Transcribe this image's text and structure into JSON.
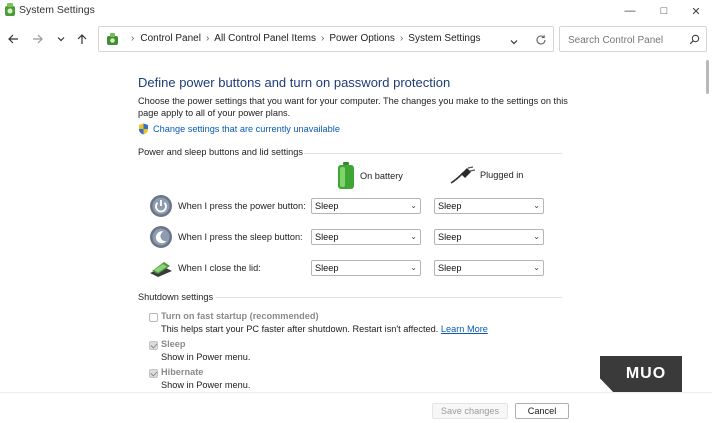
{
  "window": {
    "title": "System Settings",
    "minimize_glyph": "—",
    "maximize_glyph": "□",
    "close_glyph": "✕"
  },
  "nav": {
    "breadcrumbs": [
      "Control Panel",
      "All Control Panel Items",
      "Power Options",
      "System Settings"
    ],
    "search_placeholder": "Search Control Panel"
  },
  "page": {
    "heading": "Define power buttons and turn on password protection",
    "description": "Choose the power settings that you want for your computer. The changes you make to the settings on this page apply to all of your power plans.",
    "admin_link": "Change settings that are currently unavailable"
  },
  "power_group": {
    "label": "Power and sleep buttons and lid settings",
    "col_battery": "On battery",
    "col_plugged": "Plugged in",
    "rows": [
      {
        "label": "When I press the power button:",
        "battery": "Sleep",
        "plugged": "Sleep"
      },
      {
        "label": "When I press the sleep button:",
        "battery": "Sleep",
        "plugged": "Sleep"
      },
      {
        "label": "When I close the lid:",
        "battery": "Sleep",
        "plugged": "Sleep"
      }
    ]
  },
  "shutdown_group": {
    "label": "Shutdown settings",
    "options": [
      {
        "title": "Turn on fast startup (recommended)",
        "desc": "This helps start your PC faster after shutdown. Restart isn't affected.",
        "link": "Learn More",
        "checked": false
      },
      {
        "title": "Sleep",
        "desc": "Show in Power menu.",
        "checked": true
      },
      {
        "title": "Hibernate",
        "desc": "Show in Power menu.",
        "checked": true
      }
    ]
  },
  "footer": {
    "save_label": "Save changes",
    "cancel_label": "Cancel"
  },
  "watermark": "MUO",
  "colors": {
    "heading": "#1e3c7a",
    "link": "#0a5bb5"
  }
}
